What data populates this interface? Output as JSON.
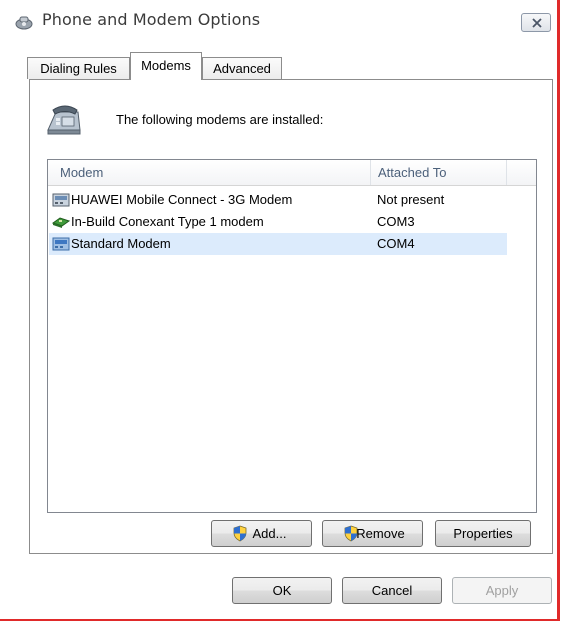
{
  "window": {
    "title": "Phone and Modem Options",
    "close_glyph": "✕"
  },
  "tabs": [
    {
      "label": "Dialing Rules",
      "selected": false
    },
    {
      "label": "Modems",
      "selected": true
    },
    {
      "label": "Advanced",
      "selected": false
    }
  ],
  "modems_tab": {
    "intro": "The following modems are installed:",
    "columns": {
      "modem": "Modem",
      "attached_to": "Attached To"
    },
    "rows": [
      {
        "name": "HUAWEI Mobile Connect - 3G Modem",
        "attached_to": "Not present",
        "icon": "modem-icon",
        "selected": false
      },
      {
        "name": "In-Build Conexant Type 1 modem",
        "attached_to": "COM3",
        "icon": "modem-card-icon",
        "selected": false
      },
      {
        "name": "Standard Modem",
        "attached_to": "COM4",
        "icon": "modem-icon",
        "selected": true
      }
    ],
    "buttons": {
      "add": "Add...",
      "remove": "Remove",
      "properties": "Properties"
    }
  },
  "dialog_buttons": {
    "ok": "OK",
    "cancel": "Cancel",
    "apply": "Apply"
  },
  "colors": {
    "accent_border": "#e02a2a",
    "selection": "#dcebfc",
    "header_text": "#4c607a"
  }
}
